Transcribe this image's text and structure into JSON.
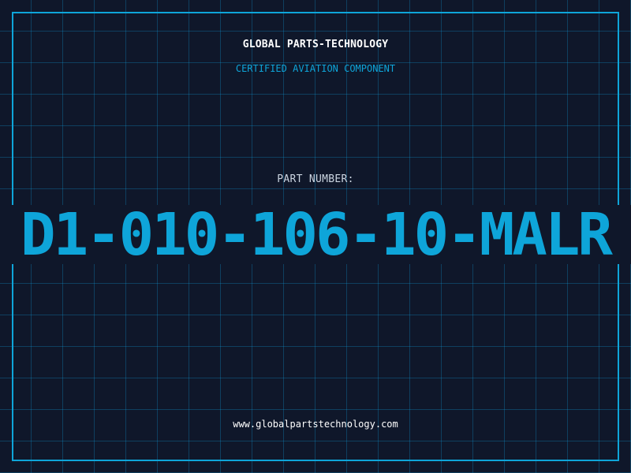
{
  "header": {
    "brand": "GLOBAL PARTS-TECHNOLOGY",
    "subtitle": "CERTIFIED AVIATION COMPONENT"
  },
  "part": {
    "label": "PART NUMBER:",
    "number": "D1-010-106-10-MALR"
  },
  "footer": {
    "website": "www.globalpartstechnology.com"
  },
  "colors": {
    "background": "#0f172a",
    "accent": "#0ea5d9",
    "grid": "#0ea5e9",
    "text": "#ffffff",
    "label": "#cbd5e1"
  }
}
